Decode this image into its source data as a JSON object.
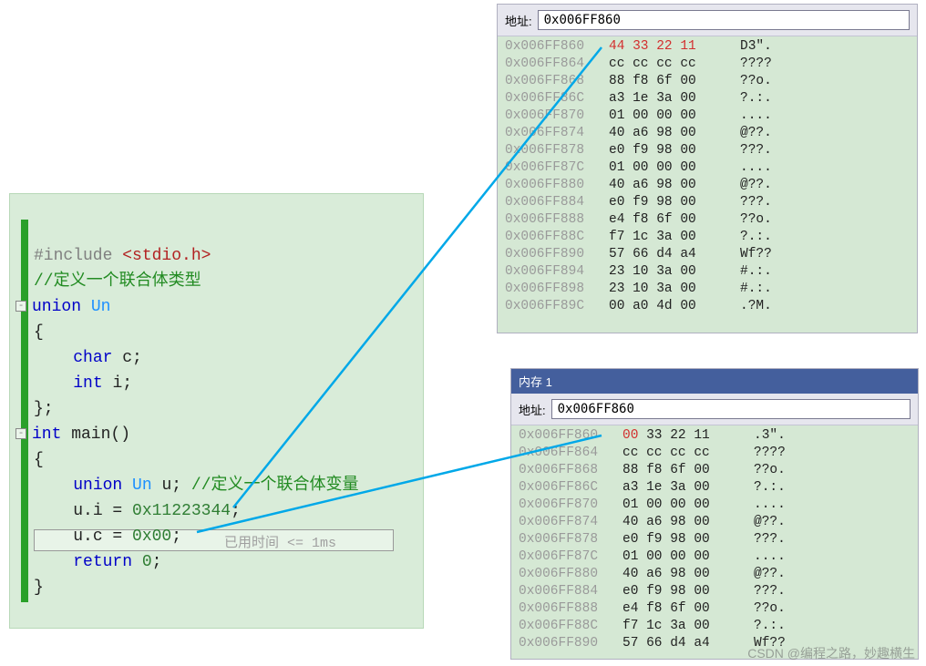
{
  "code": {
    "include_pre": "#include ",
    "include_hdr": "<stdio.h>",
    "cmt_union": "//定义一个联合体类型",
    "kw_union": "union",
    "typ_Un": "Un",
    "lbrace": "{",
    "kw_char": "char",
    "id_c": "c;",
    "kw_int": "int",
    "id_i": "i;",
    "rbrace_semi": "};",
    "main_decl_int": "int",
    "main_decl_rest": " main()",
    "lbrace2": "{",
    "var_union": "union",
    "var_Un": "Un",
    "var_u": "u;",
    "cmt_var": "//定义一个联合体变量",
    "line_ui": "u.i = ",
    "num_ui": "0x11223344",
    "semi_ui": ";",
    "line_uc": "u.c = ",
    "num_uc": "0x00",
    "semi_uc": ";",
    "kw_return": "return",
    "num_zero": " 0",
    "semi_ret": ";",
    "rbrace2": "}",
    "annot_time_label": "已用时间 ",
    "annot_time_val": "<= 1ms"
  },
  "mem1": {
    "addr_label": "地址:",
    "addr_value": "0x006FF860",
    "rows": [
      {
        "addr": "0x006FF860",
        "bytes": "44 33 22 11",
        "ascii": "D3\".",
        "hl": true
      },
      {
        "addr": "0x006FF864",
        "bytes": "cc cc cc cc",
        "ascii": "????"
      },
      {
        "addr": "0x006FF868",
        "bytes": "88 f8 6f 00",
        "ascii": "??o."
      },
      {
        "addr": "0x006FF86C",
        "bytes": "a3 1e 3a 00",
        "ascii": "?.:."
      },
      {
        "addr": "0x006FF870",
        "bytes": "01 00 00 00",
        "ascii": "...."
      },
      {
        "addr": "0x006FF874",
        "bytes": "40 a6 98 00",
        "ascii": "@??."
      },
      {
        "addr": "0x006FF878",
        "bytes": "e0 f9 98 00",
        "ascii": "???."
      },
      {
        "addr": "0x006FF87C",
        "bytes": "01 00 00 00",
        "ascii": "...."
      },
      {
        "addr": "0x006FF880",
        "bytes": "40 a6 98 00",
        "ascii": "@??."
      },
      {
        "addr": "0x006FF884",
        "bytes": "e0 f9 98 00",
        "ascii": "???."
      },
      {
        "addr": "0x006FF888",
        "bytes": "e4 f8 6f 00",
        "ascii": "??o."
      },
      {
        "addr": "0x006FF88C",
        "bytes": "f7 1c 3a 00",
        "ascii": "?.:."
      },
      {
        "addr": "0x006FF890",
        "bytes": "57 66 d4 a4",
        "ascii": "Wf??"
      },
      {
        "addr": "0x006FF894",
        "bytes": "23 10 3a 00",
        "ascii": "#.:."
      },
      {
        "addr": "0x006FF898",
        "bytes": "23 10 3a 00",
        "ascii": "#.:."
      },
      {
        "addr": "0x006FF89C",
        "bytes": "00 a0 4d 00",
        "ascii": ".?M."
      }
    ]
  },
  "mem2": {
    "title": "内存 1",
    "addr_label": "地址:",
    "addr_value": "0x006FF860",
    "rows": [
      {
        "addr": "0x006FF860",
        "b0": "00",
        "brest": "33 22 11",
        "ascii": ".3\".",
        "hl0": true
      },
      {
        "addr": "0x006FF864",
        "bytes": "cc cc cc cc",
        "ascii": "????"
      },
      {
        "addr": "0x006FF868",
        "bytes": "88 f8 6f 00",
        "ascii": "??o."
      },
      {
        "addr": "0x006FF86C",
        "bytes": "a3 1e 3a 00",
        "ascii": "?.:."
      },
      {
        "addr": "0x006FF870",
        "bytes": "01 00 00 00",
        "ascii": "...."
      },
      {
        "addr": "0x006FF874",
        "bytes": "40 a6 98 00",
        "ascii": "@??."
      },
      {
        "addr": "0x006FF878",
        "bytes": "e0 f9 98 00",
        "ascii": "???."
      },
      {
        "addr": "0x006FF87C",
        "bytes": "01 00 00 00",
        "ascii": "...."
      },
      {
        "addr": "0x006FF880",
        "bytes": "40 a6 98 00",
        "ascii": "@??."
      },
      {
        "addr": "0x006FF884",
        "bytes": "e0 f9 98 00",
        "ascii": "???."
      },
      {
        "addr": "0x006FF888",
        "bytes": "e4 f8 6f 00",
        "ascii": "??o."
      },
      {
        "addr": "0x006FF88C",
        "bytes": "f7 1c 3a 00",
        "ascii": "?.:."
      },
      {
        "addr": "0x006FF890",
        "bytes": "57 66 d4 a4",
        "ascii": "Wf??"
      }
    ]
  },
  "watermark": "CSDN @编程之路，妙趣横生"
}
